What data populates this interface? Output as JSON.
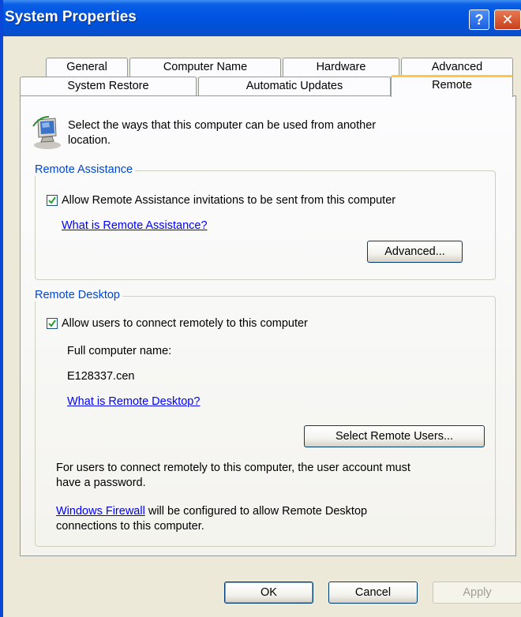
{
  "window": {
    "title": "System Properties",
    "help_glyph": "?",
    "close_glyph": "✕"
  },
  "tabs_row1": [
    "General",
    "Computer Name",
    "Hardware",
    "Advanced"
  ],
  "tabs_row2": [
    "System Restore",
    "Automatic Updates",
    "Remote"
  ],
  "active_tab": "Remote",
  "intro": {
    "icon": "remote-computer-icon",
    "line1": "Select the ways that this computer can be used from another",
    "line2": "location."
  },
  "remote_assistance": {
    "group_label": "Remote Assistance",
    "checkbox_label": "Allow Remote Assistance invitations to be sent from this computer",
    "checked": true,
    "link": "What is Remote Assistance?",
    "advanced_button": "Advanced..."
  },
  "remote_desktop": {
    "group_label": "Remote Desktop",
    "checkbox_label": "Allow users to connect remotely to this computer",
    "checked": true,
    "full_name_label": "Full computer name:",
    "full_name_value": "E128337.cen",
    "link": "What is Remote Desktop?",
    "select_users_button": "Select Remote Users...",
    "note_line1": "For users to connect remotely to this computer, the user account must",
    "note_line2": "have a password.",
    "firewall_link": "Windows Firewall",
    "firewall_rest": " will be configured to allow Remote Desktop",
    "firewall_line2": "connections to this computer."
  },
  "buttons": {
    "ok": "OK",
    "cancel": "Cancel",
    "apply": "Apply"
  }
}
